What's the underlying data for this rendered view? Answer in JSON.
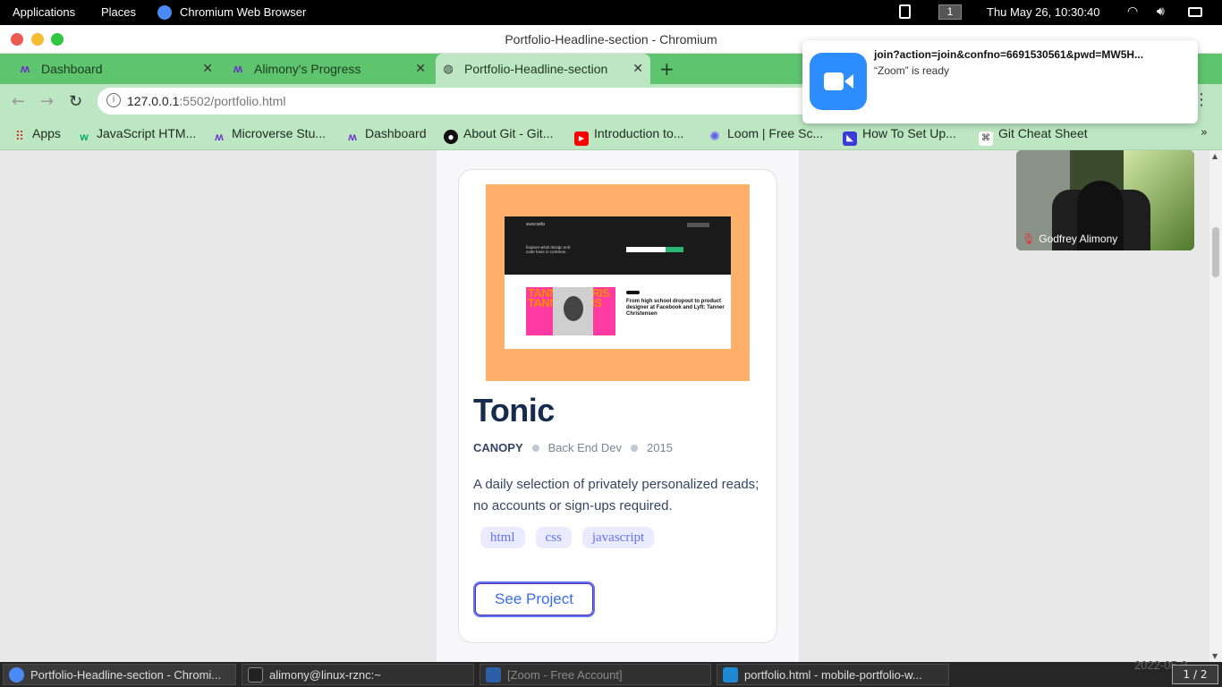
{
  "topbar": {
    "applications": "Applications",
    "places": "Places",
    "app_name": "Chromium Web Browser",
    "workspace": "1",
    "datetime": "Thu May 26, 10:30:40"
  },
  "window": {
    "title": "Portfolio-Headline-section - Chromium"
  },
  "tabs": [
    {
      "label": "Dashboard",
      "close": "✕"
    },
    {
      "label": "Alimony's Progress",
      "close": "✕"
    },
    {
      "label": "Portfolio-Headline-section",
      "close": "✕",
      "active": true
    }
  ],
  "newtab": "+",
  "nav": {
    "url_host": "127.0.0.1",
    "url_rest": ":5502/portfolio.html"
  },
  "bookmarks": [
    {
      "label": "Apps",
      "icon": "apps-grid-icon"
    },
    {
      "label": "JavaScript HTM...",
      "icon": "w3schools-icon"
    },
    {
      "label": "Microverse Stu...",
      "icon": "microverse-icon"
    },
    {
      "label": "Dashboard",
      "icon": "microverse-icon"
    },
    {
      "label": "About Git - Git...",
      "icon": "github-icon"
    },
    {
      "label": "Introduction to...",
      "icon": "youtube-icon"
    },
    {
      "label": "Loom | Free Sc...",
      "icon": "loom-icon"
    },
    {
      "label": "How To Set Up...",
      "icon": "bookmark-icon"
    },
    {
      "label": "Git Cheat Sheet",
      "icon": "command-icon"
    }
  ],
  "bookmarks_more": "»",
  "card": {
    "screenshot": {
      "logo": "avocado",
      "tagline": "Explore what design and code have in common.",
      "thumb_text": "TANNER CHRIS TANNE CHRIS",
      "headline": "From high school dropout to product designer at Facebook and Lyft: Tanner Christensen"
    },
    "title": "Tonic",
    "client": "CANOPY",
    "role": "Back End Dev",
    "year": "2015",
    "description": "A daily selection of privately personalized reads; no accounts or sign-ups required.",
    "tags": [
      "html",
      "css",
      "javascript"
    ],
    "button": "See Project"
  },
  "notification": {
    "title": "join?action=join&confno=6691530561&pwd=MW5H...",
    "body": "“Zoom” is ready"
  },
  "video": {
    "participant": "Godfrey Alimony"
  },
  "taskbar": {
    "items": [
      {
        "label": "Portfolio-Headline-section - Chromi...",
        "icon": "chromium-icon"
      },
      {
        "label": "alimony@linux-rznc:~",
        "icon": "terminal-icon"
      },
      {
        "label": "[Zoom - Free Account]",
        "icon": "zoom-icon"
      },
      {
        "label": "portfolio.html - mobile-portfolio-w...",
        "icon": "vscode-icon"
      }
    ],
    "date_overlay": "2022-05-2",
    "pager": "1 / 2"
  },
  "colors": {
    "tab_strip": "#5ec46e",
    "toolbar": "#bde7c3",
    "project_image_bg": "#ffb06b",
    "title": "#172b4d",
    "tag_bg": "#ebebff",
    "tag_text": "#6070ff",
    "button_border": "#6070ff"
  }
}
